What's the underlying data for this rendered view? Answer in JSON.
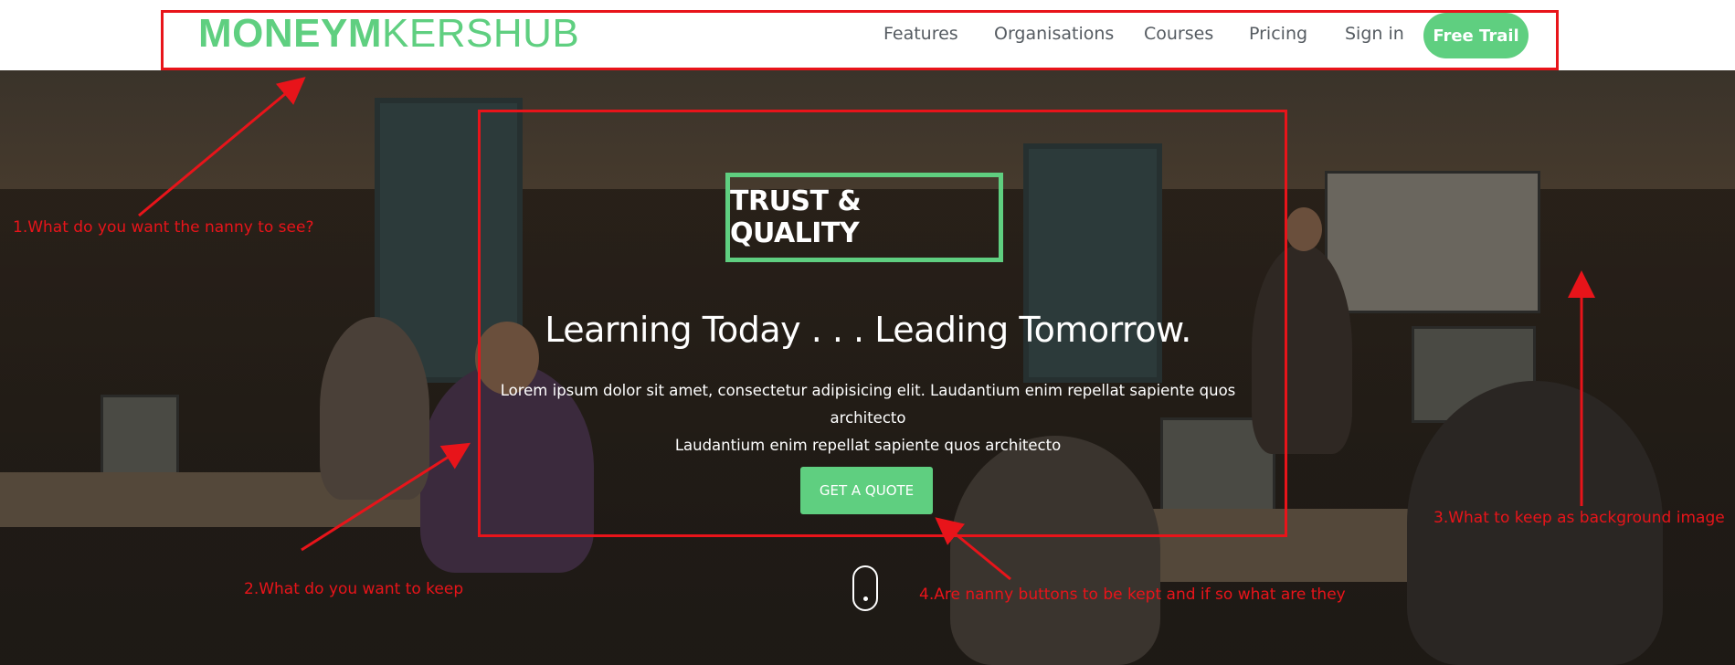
{
  "header": {
    "logo_bold": "MONEYM",
    "logo_light": "KERSHUB",
    "nav": [
      {
        "label": "Features"
      },
      {
        "label": "Organisations"
      },
      {
        "label": "Courses"
      },
      {
        "label": "Pricing"
      },
      {
        "label": "Sign in"
      }
    ],
    "cta_label": "Free Trail"
  },
  "hero": {
    "badge": "TRUST & QUALITY",
    "heading": "Learning Today . . . Leading Tomorrow.",
    "body_line1": "Lorem ipsum dolor sit amet, consectetur adipisicing elit. Laudantium enim repellat sapiente quos architecto",
    "body_line2": "Laudantium enim repellat sapiente quos architecto",
    "button_label": "GET A QUOTE"
  },
  "annotations": {
    "note1": "1.What do you want the nanny to see?",
    "note2": "2.What do you want to keep",
    "note3": "3.What to keep as background image",
    "note4": "4.Are nanny buttons to be kept and if so what are they"
  },
  "colors": {
    "accent": "#5fcf80",
    "annotation": "#e8141a",
    "nav_text": "#555b61"
  }
}
